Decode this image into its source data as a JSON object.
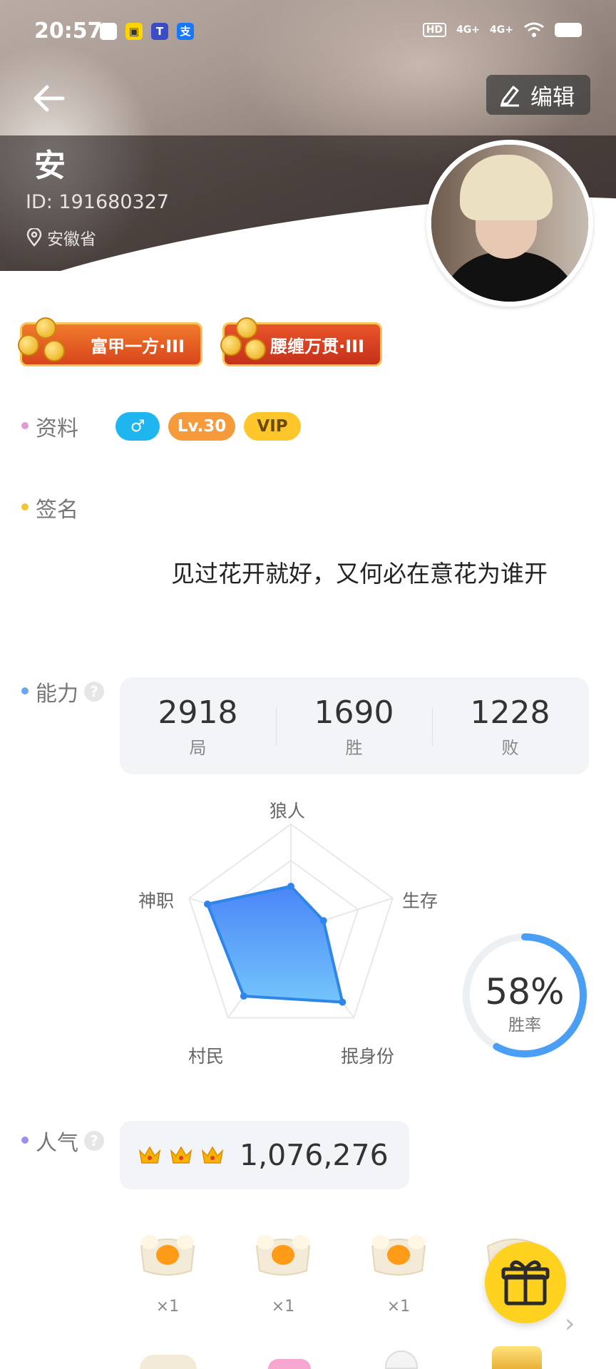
{
  "status_bar": {
    "time": "20:57",
    "network1": "HD",
    "network2": "4G+",
    "network3": "4G+"
  },
  "header": {
    "edit_label": "编辑"
  },
  "profile": {
    "name": "安",
    "id_text": "ID: 191680327",
    "location": "安徽省"
  },
  "badges": [
    "富甲一方·III",
    "腰缠万贯·III"
  ],
  "info": {
    "label": "资料",
    "tags": [
      "♂",
      "Lv.30",
      "VIP"
    ]
  },
  "signature": {
    "label": "签名",
    "text": "见过花开就好，又何必在意花为谁开"
  },
  "ability": {
    "label": "能力",
    "help": "?",
    "stats": [
      {
        "value": "2918",
        "label": "局"
      },
      {
        "value": "1690",
        "label": "胜"
      },
      {
        "value": "1228",
        "label": "败"
      }
    ],
    "radar_axes": [
      "狼人",
      "生存",
      "抿身份",
      "村民",
      "神职"
    ],
    "radar_values": [
      0.42,
      0.32,
      0.82,
      0.75,
      0.82
    ],
    "win_rate": "58%",
    "win_rate_value": 0.58,
    "win_rate_label": "胜率"
  },
  "popularity": {
    "label": "人气",
    "help": "?",
    "value": "1,076,276"
  },
  "gifts": [
    {
      "count": "×1"
    },
    {
      "count": "×1"
    },
    {
      "count": "×1"
    }
  ],
  "colors": {
    "accent": "#4a9ff5",
    "radar_fill": "#5aa8f8",
    "fab": "#ffd21f"
  }
}
